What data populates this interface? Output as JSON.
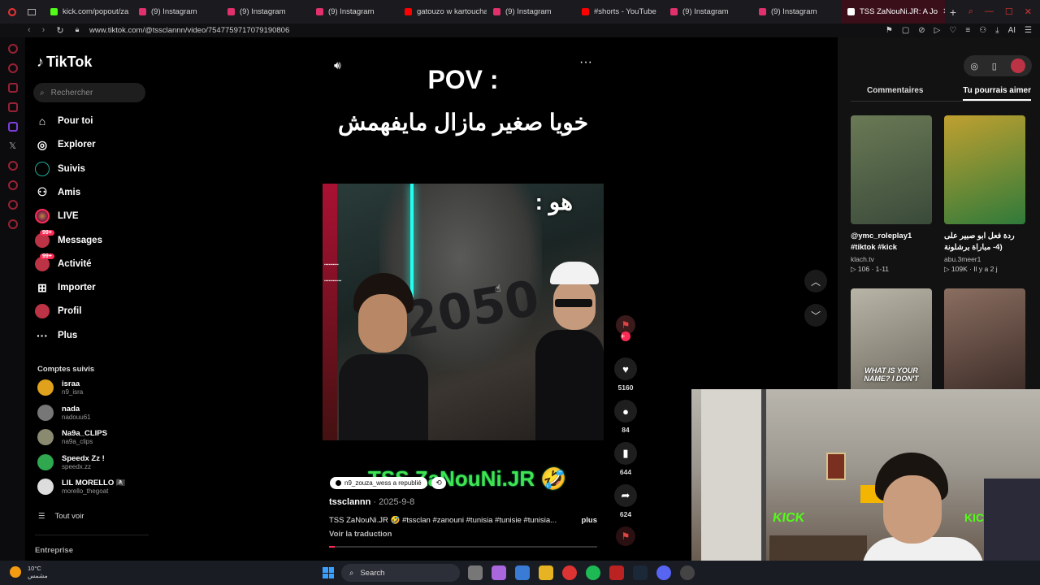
{
  "browser": {
    "tabs": [
      {
        "label": "kick.com/popout/za",
        "color": "#53fc18"
      },
      {
        "label": "(9) Instagram",
        "color": "#e1306c"
      },
      {
        "label": "(9) Instagram",
        "color": "#e1306c"
      },
      {
        "label": "(9) Instagram",
        "color": "#e1306c"
      },
      {
        "label": "gatouzo w kartoucha",
        "color": "#ff0000"
      },
      {
        "label": "(9) Instagram",
        "color": "#e1306c"
      },
      {
        "label": "#shorts - YouTube",
        "color": "#ff0000"
      },
      {
        "label": "(9) Instagram",
        "color": "#e1306c"
      },
      {
        "label": "(9) Instagram",
        "color": "#e1306c"
      },
      {
        "label": "TSS ZaNouNi.JR: A Jo",
        "color": "#ffffff",
        "active": true
      }
    ],
    "url": "www.tiktok.com/@tssclannn/video/7547759717079190806"
  },
  "tiktok": {
    "logo": "TikTok",
    "search_placeholder": "Rechercher",
    "nav": [
      {
        "label": "Pour toi",
        "icon": "home-icon"
      },
      {
        "label": "Explorer",
        "icon": "compass-icon"
      },
      {
        "label": "Suivis",
        "icon": "following-icon"
      },
      {
        "label": "Amis",
        "icon": "friends-icon"
      },
      {
        "label": "LIVE",
        "icon": "live-icon"
      },
      {
        "label": "Messages",
        "icon": "messages-icon",
        "badge": "99+"
      },
      {
        "label": "Activité",
        "icon": "activity-icon",
        "badge": "99+"
      },
      {
        "label": "Importer",
        "icon": "upload-icon"
      },
      {
        "label": "Profil",
        "icon": "profile-icon"
      },
      {
        "label": "Plus",
        "icon": "more-icon"
      }
    ],
    "following_title": "Comptes suivis",
    "following": [
      {
        "name": "israa",
        "handle": "n9_isra",
        "color": "#e0a21c"
      },
      {
        "name": "nada",
        "handle": "nadouu61",
        "color": "#777777"
      },
      {
        "name": "Na9a_CLIPS",
        "handle": "na9a_clips",
        "color": "#8a8a70"
      },
      {
        "name": "Speedx Zz !",
        "handle": "speedx.zz",
        "color": "#2fa84f"
      },
      {
        "name": "LIL MORELLO 🏴‍☠️",
        "handle": "morello_thegoat",
        "color": "#dddddd"
      }
    ],
    "see_all": "Tout voir",
    "enterprise": "Entreprise"
  },
  "video": {
    "pov": "POV :",
    "arabic_caption": "خويا صغير مازال مايفهمش",
    "overlay_text": "هو :",
    "brand_text": "TSS ZaNouNi.JR 🤣",
    "repost_label": "n9_zouza_wess a republié",
    "author": "tssclannn",
    "date": "2025-9-8",
    "description": "TSS ZaNouNi.JR 🤣 #tssclan #zanouni #tunisia #tunisie #tunisia...",
    "more": "plus",
    "translate": "Voir la traduction",
    "progress": 0.02
  },
  "actions": {
    "likes": "5160",
    "comments": "84",
    "saves": "644",
    "shares": "624"
  },
  "right_panel": {
    "tab_comments": "Commentaires",
    "tab_suggest": "Tu pourrais aimer",
    "cards": [
      {
        "title": "@ymc_roleplay1 #tiktok #kick",
        "author": "klach.tv",
        "stats": "▷ 106 · 1-11",
        "c1": "#6a7a55",
        "c2": "#3a4a3a"
      },
      {
        "title": "ردة فعل ابو صبير على (4- مباراة برشلونة وبنفيكا",
        "author": "abu.3meer1",
        "stats": "▷ 109K · Il y a 2 j",
        "c1": "#c0a030",
        "c2": "#2f7a3a"
      },
      {
        "title": "",
        "author": "",
        "stats": "",
        "overlay": "WHAT IS YOUR NAME? I DON'T",
        "c1": "#b8b4a6",
        "c2": "#6e6a60"
      },
      {
        "title": "",
        "author": "",
        "stats": "",
        "c1": "#8a6e60",
        "c2": "#3a2a26"
      }
    ]
  },
  "taskbar": {
    "temp": "10°C",
    "condition": "مشمس",
    "search": "Search"
  }
}
